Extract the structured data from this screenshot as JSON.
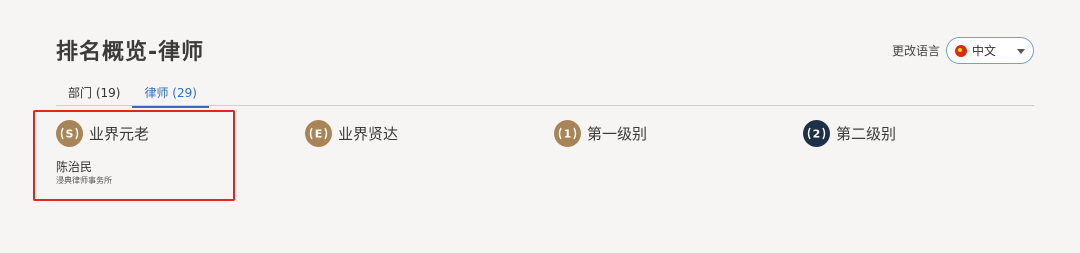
{
  "header": {
    "title": "排名概览-律师",
    "language_label": "更改语言",
    "language_value": "中文"
  },
  "tabs": [
    {
      "label": "部门 (19)",
      "active": false
    },
    {
      "label": "律师 (29)",
      "active": true
    }
  ],
  "categories": [
    {
      "label": "业界元老",
      "badge_letter": "S",
      "badge_color": "#a88556"
    },
    {
      "label": "业界贤达",
      "badge_letter": "E",
      "badge_color": "#a88556"
    },
    {
      "label": "第一级别",
      "badge_letter": "1",
      "badge_color": "#a88556"
    },
    {
      "label": "第二级别",
      "badge_letter": "2",
      "badge_color": "#1f3147"
    }
  ],
  "entries": [
    {
      "name": "陈治民",
      "firm": "浸典律师事务所"
    }
  ],
  "colors": {
    "accent": "#2d6fc0",
    "highlight": "#e0261f",
    "gold": "#a88556",
    "navy": "#1f3147"
  }
}
